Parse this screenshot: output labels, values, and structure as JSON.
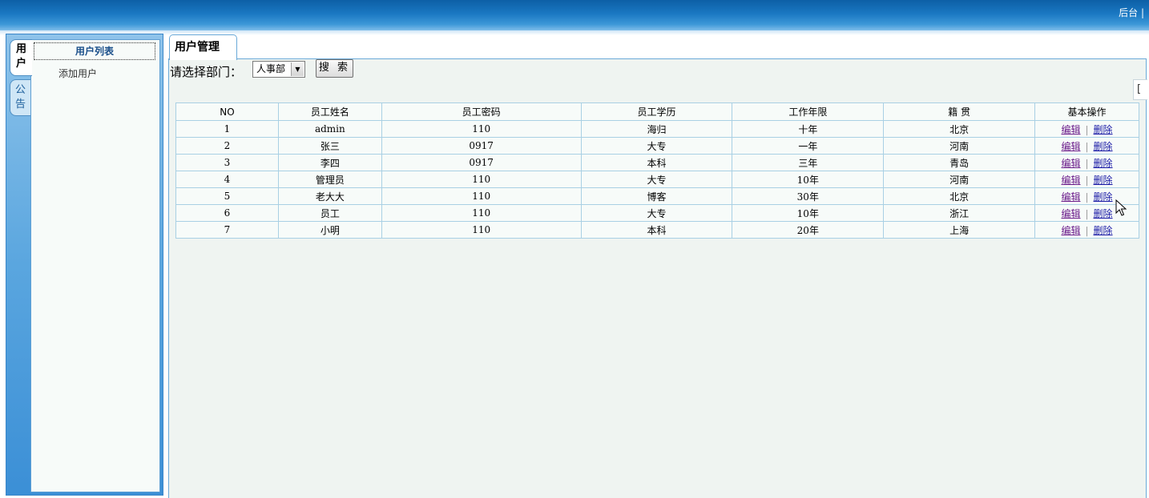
{
  "header": {
    "link": "后台 |"
  },
  "sidebar": {
    "tabs": [
      {
        "chars": [
          "用",
          "户"
        ],
        "active": true
      },
      {
        "chars": [
          "公",
          "告"
        ],
        "active": false
      }
    ],
    "menu": [
      {
        "label": "用户列表",
        "active": true
      },
      {
        "label": "添加用户",
        "active": false
      }
    ]
  },
  "main": {
    "tab": "用户管理",
    "filter": {
      "label": "请选择部门：",
      "selected": "人事部",
      "search_label": "搜 索"
    },
    "scroll_stub": "[",
    "table": {
      "headers": [
        "NO",
        "员工姓名",
        "员工密码",
        "员工学历",
        "工作年限",
        "籍 贯",
        "基本操作"
      ],
      "edit_label": "编辑",
      "delete_label": "删除",
      "separator": "|",
      "rows": [
        [
          "1",
          "admin",
          "110",
          "海归",
          "十年",
          "北京"
        ],
        [
          "2",
          "张三",
          "0917",
          "大专",
          "一年",
          "河南"
        ],
        [
          "3",
          "李四",
          "0917",
          "本科",
          "三年",
          "青岛"
        ],
        [
          "4",
          "管理员",
          "110",
          "大专",
          "10年",
          "河南"
        ],
        [
          "5",
          "老大大",
          "110",
          "博客",
          "30年",
          "北京"
        ],
        [
          "6",
          "员工",
          "110",
          "大专",
          "10年",
          "浙江"
        ],
        [
          "7",
          "小明",
          "110",
          "本科",
          "20年",
          "上海"
        ]
      ]
    }
  },
  "colors": {
    "header_blue": "#1a78c2",
    "panel_bg": "#eff4f1",
    "link_blue": "#1a1aa6",
    "link_visited": "#6a1a8a"
  }
}
